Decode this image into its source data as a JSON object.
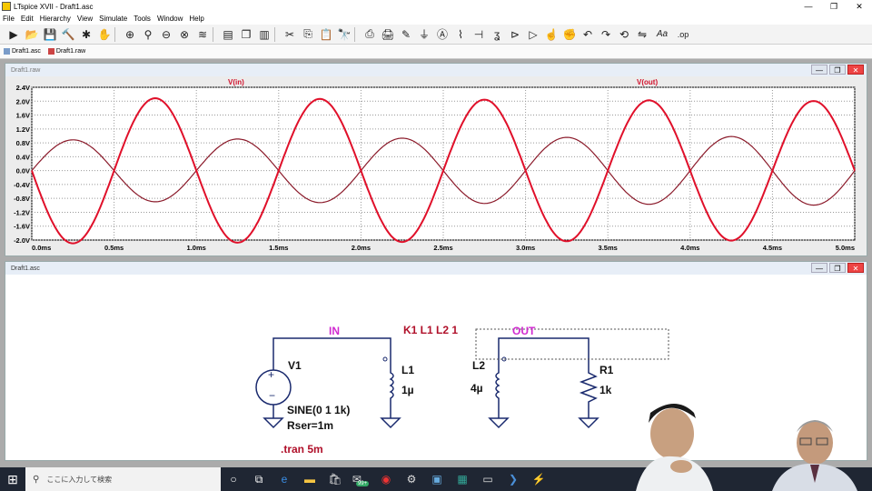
{
  "window": {
    "title": "LTspice XVII - Draft1.asc",
    "controls": [
      "—",
      "❐",
      "✕"
    ]
  },
  "menu": [
    "File",
    "Edit",
    "Hierarchy",
    "View",
    "Simulate",
    "Tools",
    "Window",
    "Help"
  ],
  "toolbar": {
    "icons": [
      "run-icon",
      "open-icon",
      "save-icon",
      "control-panel-icon",
      "halt-icon",
      "hand-icon",
      "zoom-in-icon",
      "pan-icon",
      "zoom-out-icon",
      "zoom-fit-icon",
      "autorange-icon",
      "tile-horizontal-icon",
      "cascade-icon",
      "tile-vertical-icon",
      "cut-icon",
      "copy-icon",
      "paste-icon",
      "find-icon",
      "print-icon",
      "print-setup-icon",
      "pencil-icon",
      "ground-icon",
      "label-icon",
      "resistor-icon",
      "capacitor-icon",
      "inductor-icon",
      "diode-icon",
      "component-icon",
      "move-icon",
      "drag-icon",
      "undo-icon",
      "redo-icon",
      "rotate-icon",
      "mirror-icon",
      "text-icon",
      "spice-directive-icon"
    ],
    "text_aa": "Aa",
    "text_op": ".op"
  },
  "tabs": [
    {
      "label": "Draft1.asc"
    },
    {
      "label": "Draft1.raw"
    }
  ],
  "plot_window": {
    "title": "Draft1.raw",
    "controls": [
      "—",
      "❐",
      "✕"
    ]
  },
  "schematic_window": {
    "title": "Draft1.asc",
    "controls": [
      "—",
      "❐",
      "✕"
    ]
  },
  "schematic": {
    "net_in": "IN",
    "net_out": "OUT",
    "coupling": "K1 L1 L2 1",
    "v1_name": "V1",
    "v1_value": "SINE(0 1 1k)",
    "v1_rser": "Rser=1m",
    "l1_name": "L1",
    "l1_value": "1µ",
    "l2_name": "L2",
    "l2_value": "4µ",
    "r1_name": "R1",
    "r1_value": "1k",
    "directive": ".tran 5m"
  },
  "chart_data": {
    "type": "line",
    "title": "",
    "x_unit": "ms",
    "xlim": [
      0,
      5
    ],
    "ylim": [
      -2.0,
      2.4
    ],
    "x_ticks": [
      "0.0ms",
      "0.5ms",
      "1.0ms",
      "1.5ms",
      "2.0ms",
      "2.5ms",
      "3.0ms",
      "3.5ms",
      "4.0ms",
      "4.5ms",
      "5.0ms"
    ],
    "y_ticks": [
      "2.4V",
      "2.0V",
      "1.6V",
      "1.2V",
      "0.8V",
      "0.4V",
      "0.0V",
      "-0.4V",
      "-0.8V",
      "-1.2V",
      "-1.6V",
      "-2.0V"
    ],
    "grid": true,
    "series": [
      {
        "name": "V(in)",
        "color": "#8b1a2a",
        "amplitude_start": 0.88,
        "amplitude_end": 1.0,
        "frequency_khz": 1,
        "phase": "sine"
      },
      {
        "name": "V(out)",
        "color": "#e0102a",
        "amplitude_start": 2.1,
        "amplitude_end": 2.0,
        "frequency_khz": 1,
        "phase": "inverted"
      }
    ]
  },
  "taskbar": {
    "search_placeholder": "ここに入力して検索",
    "badge": "99+",
    "apps": [
      "task-view-icon",
      "edge-icon",
      "file-explorer-icon",
      "store-icon",
      "chrome-icon",
      "settings-icon",
      "mail-icon",
      "photos-icon",
      "terminal-icon",
      "powershell-icon",
      "ltspice-icon"
    ]
  }
}
